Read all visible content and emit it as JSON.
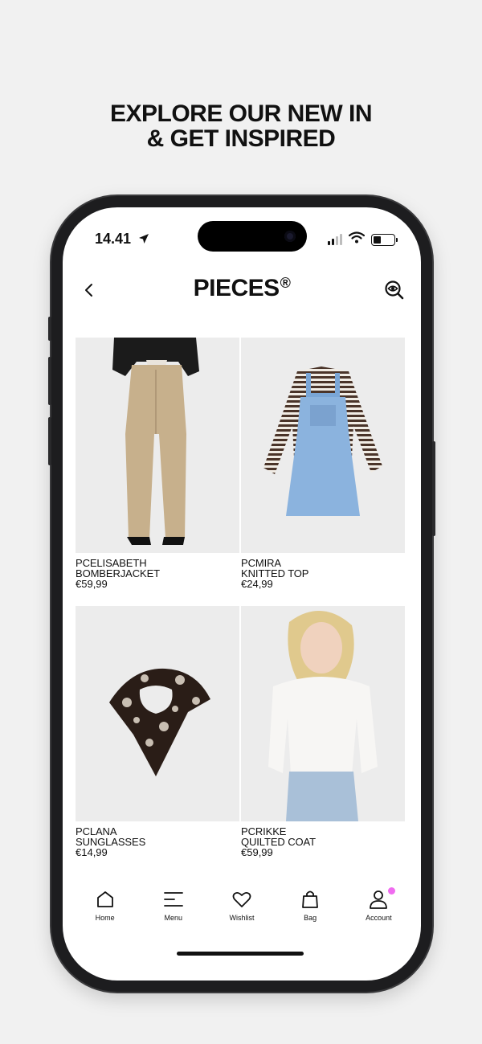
{
  "headline": {
    "line1": "EXPLORE OUR NEW IN",
    "line2": "& GET INSPIRED"
  },
  "status_bar": {
    "time": "14.41"
  },
  "app": {
    "brand": "PIECES",
    "brand_mark": "®"
  },
  "products": [
    {
      "name_line1": "PCELISABETH",
      "name_line2": "BOMBERJACKET",
      "price": "€59,99"
    },
    {
      "name_line1": "PCMIRA",
      "name_line2": "KNITTED TOP",
      "price": "€24,99"
    },
    {
      "name_line1": "PCLANA",
      "name_line2": "SUNGLASSES",
      "price": "€14,99"
    },
    {
      "name_line1": "PCRIKKE",
      "name_line2": "QUILTED COAT",
      "price": "€59,99"
    }
  ],
  "tabbar": {
    "items": [
      {
        "label": "Home",
        "icon": "home-icon"
      },
      {
        "label": "Menu",
        "icon": "menu-icon"
      },
      {
        "label": "Wishlist",
        "icon": "heart-icon"
      },
      {
        "label": "Bag",
        "icon": "bag-icon"
      },
      {
        "label": "Account",
        "icon": "account-icon"
      }
    ]
  },
  "colors": {
    "page_bg": "#f1f1f1",
    "phone_frame": "#1d1d1f",
    "badge": "#f06cf0"
  }
}
